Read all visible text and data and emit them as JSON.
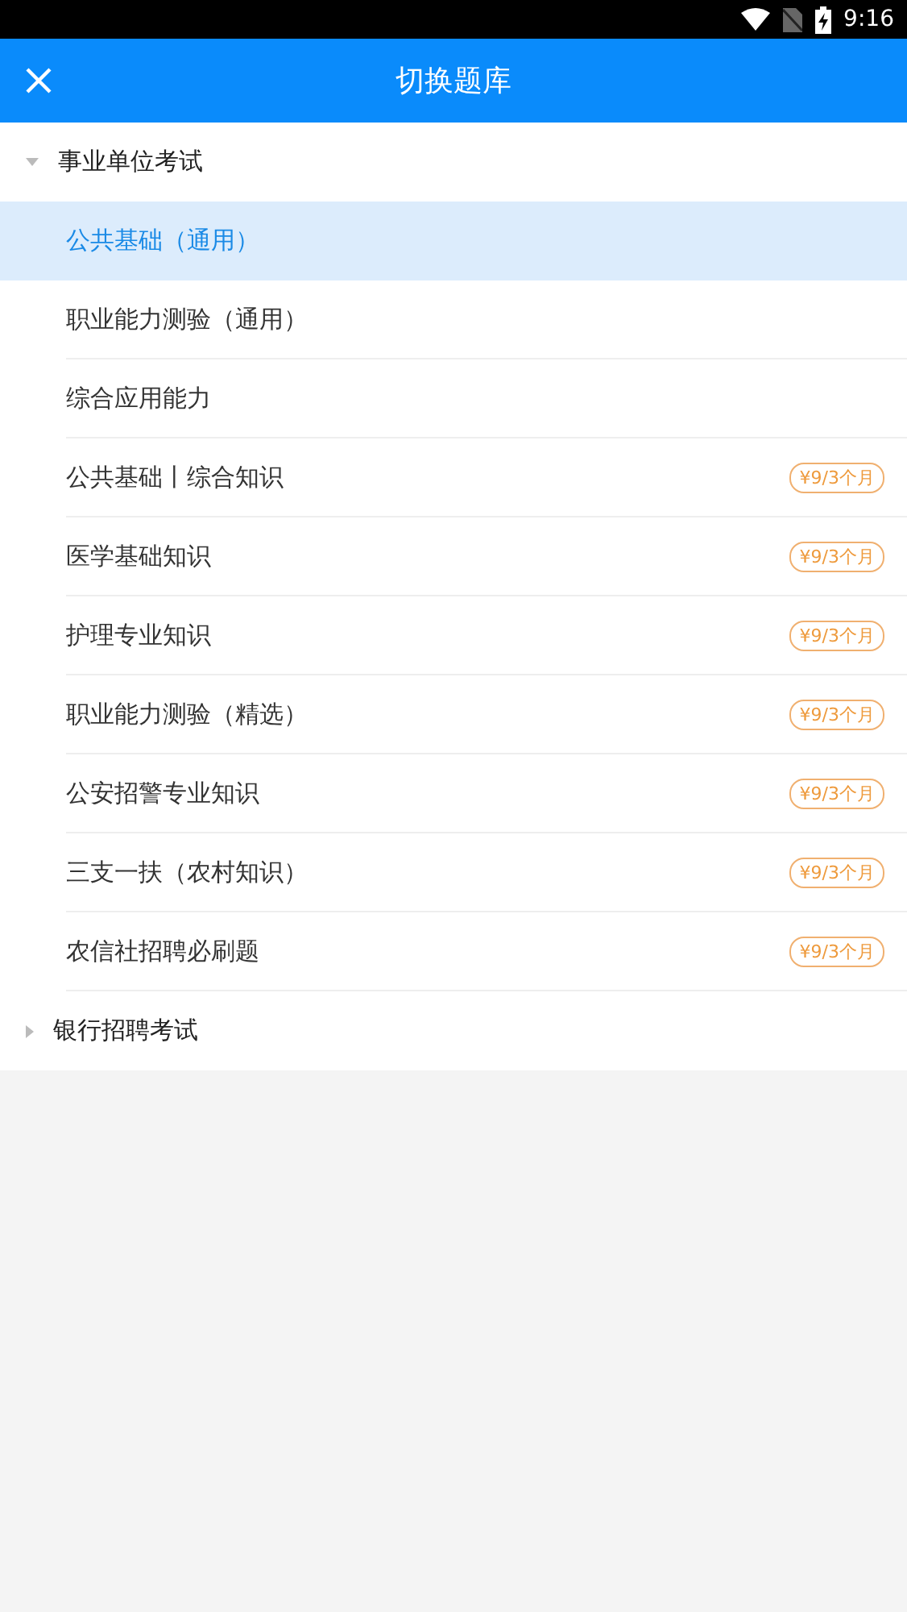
{
  "status_bar": {
    "time": "9:16"
  },
  "header": {
    "title": "切换题库"
  },
  "groups": [
    {
      "name": "事业单位考试",
      "expanded": true,
      "items": [
        {
          "name": "公共基础（通用）",
          "selected": true
        },
        {
          "name": "职业能力测验（通用）",
          "selected": false
        },
        {
          "name": "综合应用能力",
          "selected": false
        },
        {
          "name": "公共基础丨综合知识",
          "selected": false,
          "price": "¥9/3个月"
        },
        {
          "name": "医学基础知识",
          "selected": false,
          "price": "¥9/3个月"
        },
        {
          "name": "护理专业知识",
          "selected": false,
          "price": "¥9/3个月"
        },
        {
          "name": "职业能力测验（精选）",
          "selected": false,
          "price": "¥9/3个月"
        },
        {
          "name": "公安招警专业知识",
          "selected": false,
          "price": "¥9/3个月"
        },
        {
          "name": "三支一扶（农村知识）",
          "selected": false,
          "price": "¥9/3个月"
        },
        {
          "name": "农信社招聘必刷题",
          "selected": false,
          "price": "¥9/3个月"
        }
      ]
    },
    {
      "name": "银行招聘考试",
      "expanded": false
    }
  ]
}
